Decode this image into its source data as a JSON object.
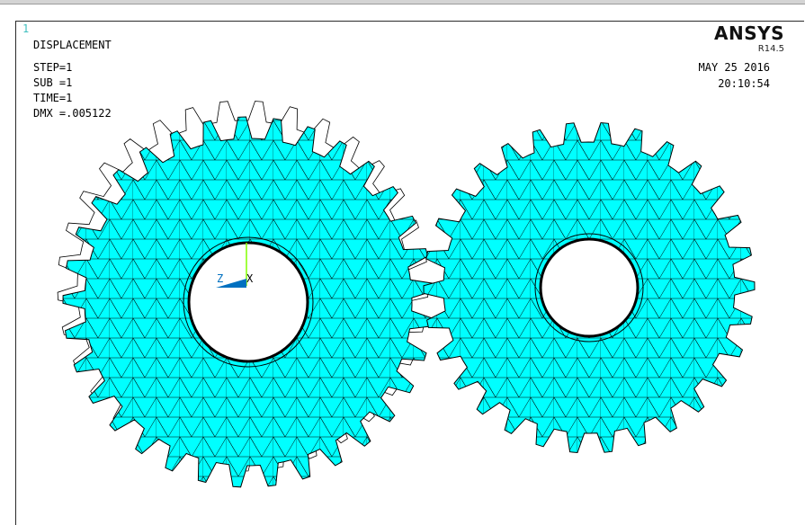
{
  "window": {
    "number": "1"
  },
  "plot": {
    "title": "DISPLACEMENT",
    "step": "STEP=1",
    "sub": "SUB =1",
    "time": "TIME=1",
    "dmx": "DMX =.005122"
  },
  "brand": {
    "name": "ANSYS",
    "release": "R14.5"
  },
  "stamp": {
    "date": "MAY 25 2016",
    "time": "20:10:54"
  },
  "triad": {
    "z_label": "Z",
    "x_label": "X"
  },
  "colors": {
    "mesh_fill": "#00ffff",
    "mesh_line": "#000000",
    "undeformed_outline": "#000000",
    "triad_z": "#0070c0",
    "triad_y": "#80ff00"
  },
  "gears": [
    {
      "name": "left-gear",
      "teeth": 33
    },
    {
      "name": "right-gear",
      "teeth": 30
    }
  ]
}
